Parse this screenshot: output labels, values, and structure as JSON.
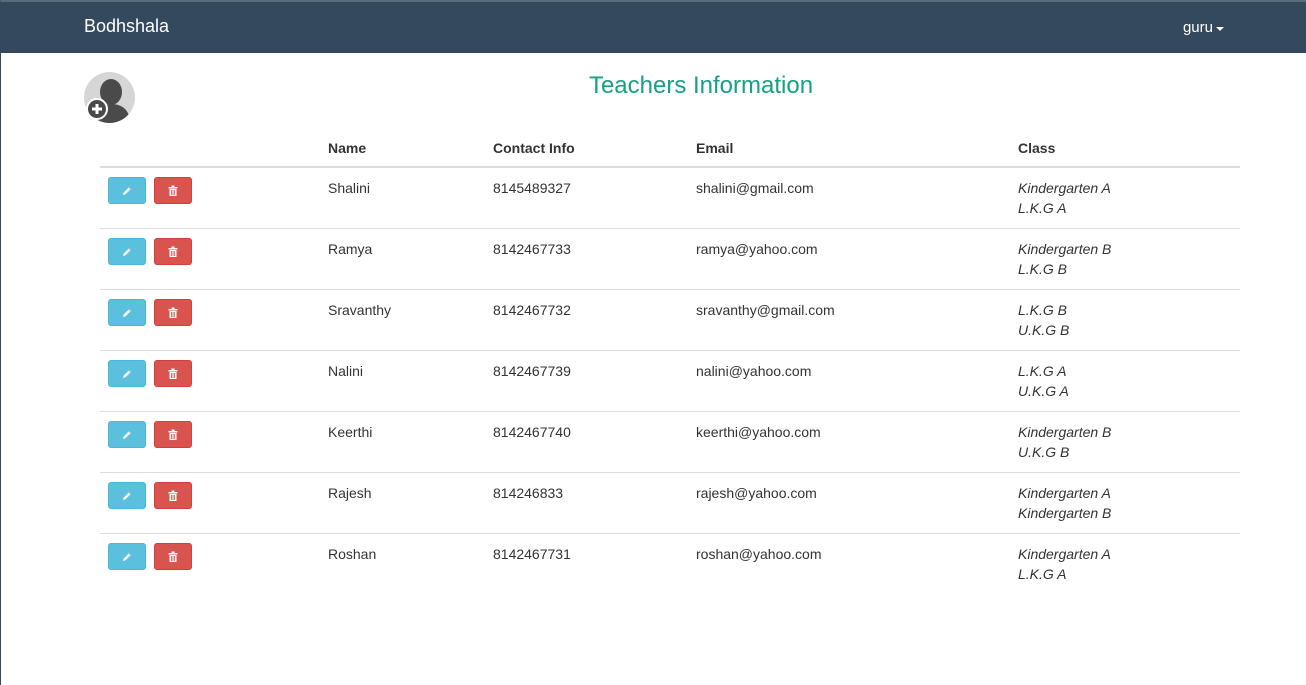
{
  "navbar": {
    "brand": "Bodhshala",
    "user": "guru"
  },
  "page": {
    "title": "Teachers Information"
  },
  "table": {
    "headers": {
      "name": "Name",
      "contact": "Contact Info",
      "email": "Email",
      "class": "Class"
    },
    "rows": [
      {
        "name": "Shalini",
        "contact": "8145489327",
        "email": "shalini@gmail.com",
        "class1": "Kindergarten A",
        "class2": "L.K.G A"
      },
      {
        "name": "Ramya",
        "contact": "8142467733",
        "email": "ramya@yahoo.com",
        "class1": "Kindergarten B",
        "class2": "L.K.G B"
      },
      {
        "name": "Sravanthy",
        "contact": "8142467732",
        "email": "sravanthy@gmail.com",
        "class1": "L.K.G B",
        "class2": "U.K.G B"
      },
      {
        "name": "Nalini",
        "contact": "8142467739",
        "email": "nalini@yahoo.com",
        "class1": "L.K.G A",
        "class2": "U.K.G A"
      },
      {
        "name": "Keerthi",
        "contact": "8142467740",
        "email": "keerthi@yahoo.com",
        "class1": "Kindergarten B",
        "class2": "U.K.G B"
      },
      {
        "name": "Rajesh",
        "contact": "814246833",
        "email": "rajesh@yahoo.com",
        "class1": "Kindergarten A",
        "class2": "Kindergarten B"
      },
      {
        "name": "Roshan",
        "contact": "8142467731",
        "email": "roshan@yahoo.com",
        "class1": "Kindergarten A",
        "class2": "L.K.G A"
      }
    ]
  },
  "icons": {
    "add_user": "add-user-icon",
    "edit": "pencil-icon",
    "delete": "trash-icon"
  },
  "colors": {
    "navbar": "#34495e",
    "title": "#16a085",
    "edit_button": "#5bc0de",
    "delete_button": "#d9534f"
  }
}
